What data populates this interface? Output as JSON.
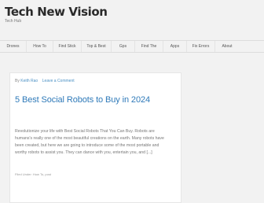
{
  "site": {
    "title": "Tech New Vision",
    "tagline": "Tech Hub"
  },
  "nav": {
    "items": [
      {
        "label": "Drones"
      },
      {
        "label": "How To"
      },
      {
        "label": "Find Stick"
      },
      {
        "label": "Top & Best"
      },
      {
        "label": "Gps"
      },
      {
        "label": "Find The"
      },
      {
        "label": "Apps"
      },
      {
        "label": "Fix Errors"
      },
      {
        "label": "About"
      }
    ]
  },
  "post": {
    "meta_prefix": "By",
    "author": "Keith Rao",
    "comment_link": "Leave a Comment",
    "title": "5 Best Social Robots to Buy in 2024",
    "excerpt_lines": [
      "Revolutionize your life with Best Social Robots That You Can Buy. Robots are",
      "humans's really one of the most beautiful creations on the earth. Many robots have",
      "been created, but here we are going to introduce some of the most portable and",
      "worthy robots to assist you. They can dance with you, entertain you, and [...]"
    ],
    "footer": "Filed Under: How To, post"
  }
}
